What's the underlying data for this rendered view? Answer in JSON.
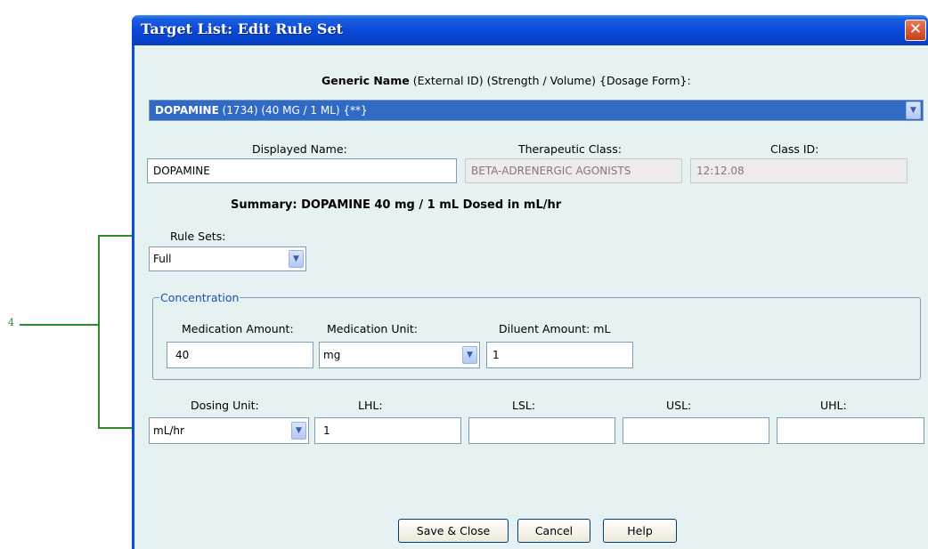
{
  "annotation": {
    "label": "4"
  },
  "window": {
    "title": "Target List:  Edit Rule Set",
    "close_glyph": "✕"
  },
  "generic_name": {
    "header_bold": "Generic Name",
    "header_rest": " (External ID)  (Strength / Volume)  {Dosage Form}:",
    "selected_bold": "DOPAMINE",
    "selected_rest": "  (1734)  (40 MG / 1 ML)  {**}"
  },
  "displayed_name": {
    "label": "Displayed Name:",
    "value": "DOPAMINE"
  },
  "therapeutic_class": {
    "label": "Therapeutic Class:",
    "value": "BETA-ADRENERGIC AGONISTS"
  },
  "class_id": {
    "label": "Class ID:",
    "value": "12:12.08"
  },
  "summary": "Summary:  DOPAMINE 40 mg / 1 mL Dosed in mL/hr",
  "rule_sets": {
    "label": "Rule Sets:",
    "value": "Full"
  },
  "concentration": {
    "legend": "Concentration",
    "medication_amount": {
      "label": "Medication Amount:",
      "value": "40"
    },
    "medication_unit": {
      "label": "Medication Unit:",
      "value": "mg"
    },
    "diluent_amount": {
      "label": "Diluent Amount: mL",
      "value": "1"
    }
  },
  "dosing_unit": {
    "label": "Dosing Unit:",
    "value": "mL/hr"
  },
  "limits": {
    "lhl": {
      "label": "LHL:",
      "value": "1"
    },
    "lsl": {
      "label": "LSL:",
      "value": ""
    },
    "usl": {
      "label": "USL:",
      "value": ""
    },
    "uhl": {
      "label": "UHL:",
      "value": ""
    }
  },
  "buttons": {
    "save_close": "Save & Close",
    "cancel": "Cancel",
    "help": "Help"
  }
}
